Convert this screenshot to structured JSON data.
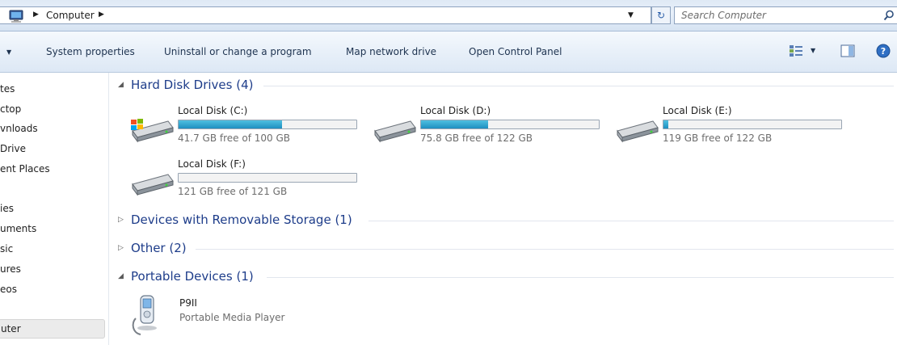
{
  "address_bar": {
    "breadcrumb": "Computer",
    "search_placeholder": "Search Computer"
  },
  "toolbar": {
    "system_properties": "System properties",
    "uninstall": "Uninstall or change a program",
    "map_drive": "Map network drive",
    "control_panel": "Open Control Panel"
  },
  "nav": {
    "items": [
      "tes",
      "ctop",
      "vnloads",
      "Drive",
      "ent Places",
      "ies",
      "uments",
      "sic",
      "ures",
      "eos"
    ],
    "selected": "uter"
  },
  "groups": {
    "hard_disks": {
      "label": "Hard Disk Drives (4)",
      "expanded": true
    },
    "removable": {
      "label": "Devices with Removable Storage (1)",
      "expanded": false
    },
    "other": {
      "label": "Other (2)",
      "expanded": false
    },
    "portable": {
      "label": "Portable Devices (1)",
      "expanded": true
    }
  },
  "drives": [
    {
      "name": "Local Disk (C:)",
      "free_text": "41.7 GB free of 100 GB",
      "used_fraction": 0.583,
      "system": true
    },
    {
      "name": "Local Disk (D:)",
      "free_text": "75.8 GB free of 122 GB",
      "used_fraction": 0.379,
      "system": false
    },
    {
      "name": "Local Disk (E:)",
      "free_text": "119 GB free of 122 GB",
      "used_fraction": 0.025,
      "system": false
    },
    {
      "name": "Local Disk (F:)",
      "free_text": "121 GB free of 121 GB",
      "used_fraction": 0.0,
      "system": false
    }
  ],
  "device": {
    "name": "P9II",
    "type": "Portable Media Player"
  },
  "colors": {
    "group_header": "#1e3d8a",
    "bar_fill": "#26a0da",
    "secondary_text": "#6d6d6d"
  }
}
